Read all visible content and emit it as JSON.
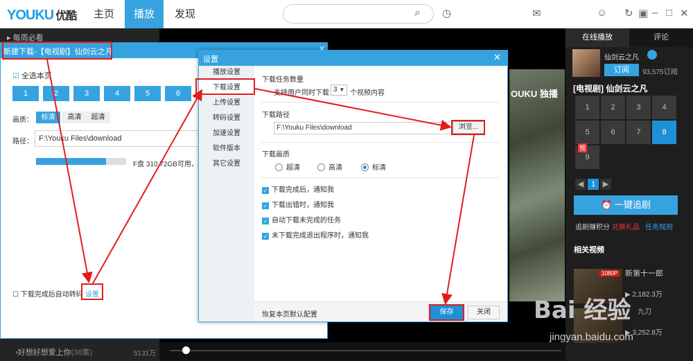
{
  "app": {
    "logo": "YOUKU",
    "logo_cn": "优酷"
  },
  "nav": {
    "home": "主页",
    "play": "播放",
    "discover": "发现"
  },
  "search": {
    "placeholder": ""
  },
  "left": {
    "header": "每周必看",
    "footer_item": "好想好想爱上你",
    "footer_count": "(38集)",
    "footer_views": "5131万"
  },
  "video": {
    "watermark": "OUKU 独播"
  },
  "right": {
    "tab_live": "在线播放",
    "tab_comment": "评论",
    "show_name": "仙剑云之凡",
    "subscribe": "订阅",
    "subscribers": "93,575订阅",
    "series_title": "[电视剧] 仙剑云之凡",
    "episodes": [
      "1",
      "2",
      "3",
      "4",
      "5",
      "6",
      "7",
      "8",
      "9"
    ],
    "active_episode": "8",
    "new_badge": "预",
    "page": "1",
    "follow_button": "一键追剧",
    "follow_points": "追剧赚积分",
    "redeem": "兑换礼品",
    "tasks": "任务规则",
    "related_title": "相关视频",
    "related": [
      {
        "name": "新第十一郎",
        "badge": "1080P",
        "plays": "2,182.3万"
      },
      {
        "name": "九刀",
        "plays": "3,252.8万"
      }
    ]
  },
  "download_dialog": {
    "title": "新建下载-【电视剧】仙剑云之凡",
    "select_all": "全选本页",
    "episodes": [
      "1",
      "2",
      "3",
      "4",
      "5",
      "6"
    ],
    "quality_label": "画质：",
    "qualities": [
      "标清",
      "高清",
      "超清"
    ],
    "path_label": "路径：",
    "path_value": "F:\\Youku Files\\download",
    "disk_info": "F盘 310.72GB可用，共",
    "disk_used_fraction": 0.78,
    "auto_transcode": "下载完成后自动转码",
    "settings_link": "设置"
  },
  "settings_dialog": {
    "title": "设置",
    "menu": [
      "播放设置",
      "下载设置",
      "上传设置",
      "转码设置",
      "加速设置",
      "软件版本",
      "其它设置"
    ],
    "active_menu": "下载设置",
    "task_count_title": "下载任务数量",
    "concurrent_prefix": "支持用户同时下载",
    "concurrent_value": "3",
    "concurrent_suffix": "个视频内容",
    "path_title": "下载路径",
    "path_value": "F:\\Youku Files\\download",
    "browse": "浏览...",
    "quality_title": "下载画质",
    "qualities": [
      "超清",
      "高清",
      "标清"
    ],
    "selected_quality": "标清",
    "options": [
      "下载完成后，通知我",
      "下载出错时，通知我",
      "自动下载未完成的任务",
      "未下载完成退出程序时，通知我"
    ],
    "restore": "恢复本页默认配置",
    "save": "保存",
    "close": "关闭"
  },
  "watermark": {
    "brand": "Bai 经验",
    "url": "jingyan.baidu.com"
  },
  "colors": {
    "accent": "#36a3e0",
    "annotation": "#e31b1b"
  }
}
